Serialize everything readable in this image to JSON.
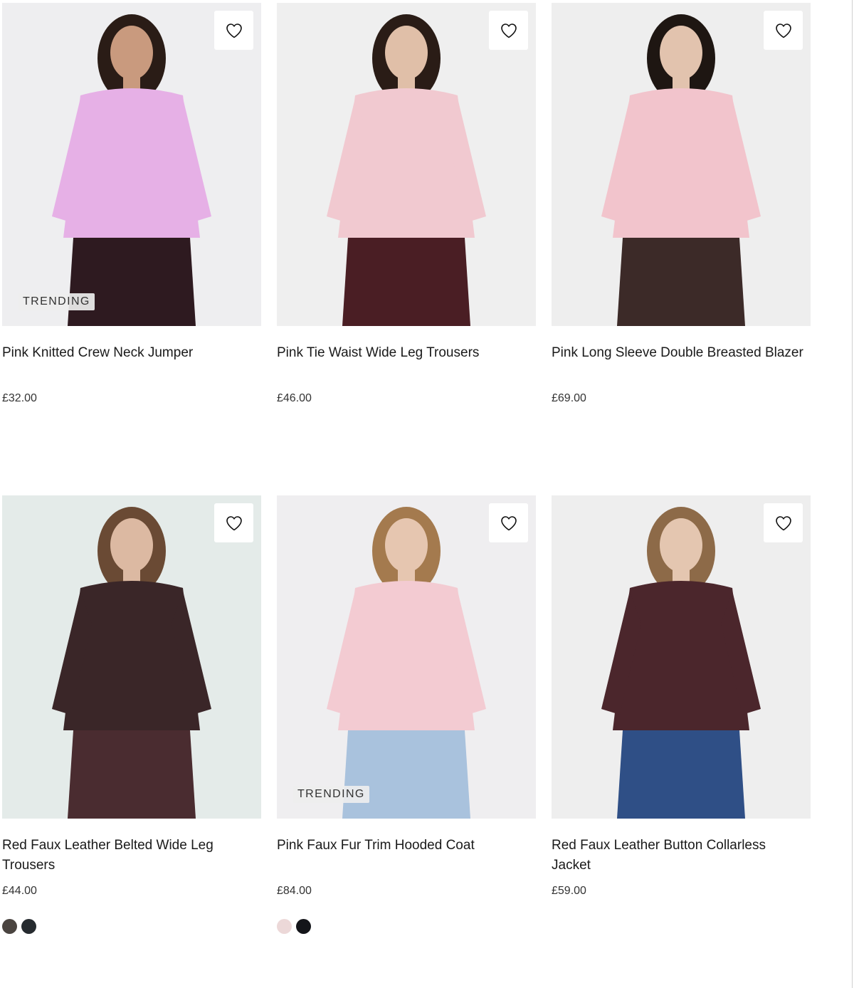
{
  "products": [
    {
      "title": "Pink Knitted Crew Neck Jumper",
      "price": "£32.00",
      "badge": "TRENDING",
      "image": {
        "bg": "#eeeef0",
        "garment": "#e6b0e6",
        "accent": "#2e1a20",
        "skin": "#c99a7e",
        "hair": "#2a1c16"
      },
      "swatches": []
    },
    {
      "title": "Pink Tie Waist Wide Leg Trousers",
      "price": "£46.00",
      "badge": "",
      "image": {
        "bg": "#efefef",
        "garment": "#f1c9d0",
        "accent": "#4a1e24",
        "skin": "#e0bfa8",
        "hair": "#2a1c16"
      },
      "swatches": []
    },
    {
      "title": "Pink Long Sleeve Double Breasted Blazer",
      "price": "£69.00",
      "badge": "",
      "image": {
        "bg": "#eeeeee",
        "garment": "#f2c4cc",
        "accent": "#3c2a28",
        "skin": "#e2c3ae",
        "hair": "#1e1612"
      },
      "swatches": []
    },
    {
      "title": "Red Faux Leather Belted Wide Leg Trousers",
      "price": "£44.00",
      "badge": "",
      "image": {
        "bg": "#e4ebe9",
        "garment": "#3a2628",
        "accent": "#4a2c30",
        "skin": "#dcb9a2",
        "hair": "#6a4a34"
      },
      "swatches": [
        {
          "color": "#4a4440",
          "name": "dark-brown"
        },
        {
          "color": "#262b2f",
          "name": "charcoal"
        }
      ]
    },
    {
      "title": "Pink Faux Fur Trim Hooded Coat",
      "price": "£84.00",
      "badge": "TRENDING",
      "image": {
        "bg": "#efeef0",
        "garment": "#f3cbd2",
        "accent": "#a9c2dd",
        "skin": "#e6c6b0",
        "hair": "#a47a4e"
      },
      "swatches": [
        {
          "color": "#ecd8d8",
          "name": "blush"
        },
        {
          "color": "#14151a",
          "name": "black"
        }
      ]
    },
    {
      "title": "Red Faux Leather Button Collarless Jacket",
      "price": "£59.00",
      "badge": "",
      "image": {
        "bg": "#eeeeee",
        "garment": "#4b262c",
        "accent": "#2f4f86",
        "skin": "#e4c6b0",
        "hair": "#8d6a48"
      },
      "swatches": []
    }
  ]
}
